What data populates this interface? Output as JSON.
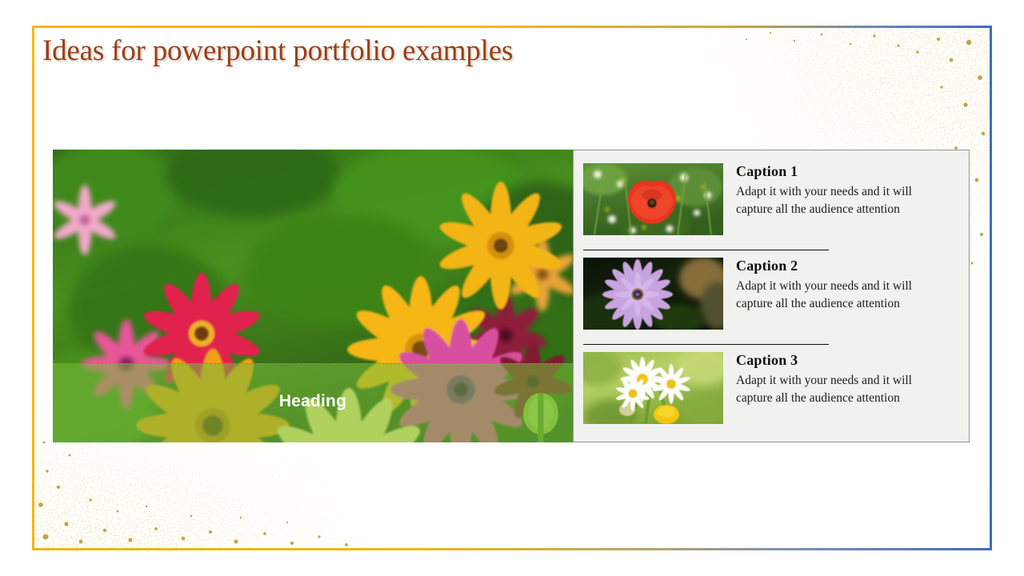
{
  "slide": {
    "title": "Ideas for powerpoint portfolio examples",
    "title_color": "#9a3f13",
    "background_color": "#ffffff",
    "frame": {
      "start_color": "#f5b811",
      "end_color": "#3d6cc0"
    },
    "decorations": {
      "top_right": "gold-glitter-confetti",
      "bottom_left": "gold-glitter-confetti",
      "glitter_color": "#c9ac4e"
    }
  },
  "hero": {
    "image_alt": "colorful-daisy-flower-field",
    "heading": "Heading",
    "heading_color": "#ffffff",
    "band_color": "#78be3c",
    "selected": true
  },
  "panel": {
    "background_color": "#f1f1f0",
    "border_color": "#949494",
    "items": [
      {
        "thumb_alt": "red-poppy-flower",
        "title": "Caption 1",
        "body": "Adapt it with your needs and it will capture all the audience attention"
      },
      {
        "thumb_alt": "purple-osteospermum-flower",
        "title": "Caption 2",
        "body": "Adapt it with your needs and it will capture all the audience attention"
      },
      {
        "thumb_alt": "white-daisy-chamomile-flowers",
        "title": "Caption 3",
        "body": "Adapt it with your needs and it will capture all the audience attention"
      }
    ]
  }
}
